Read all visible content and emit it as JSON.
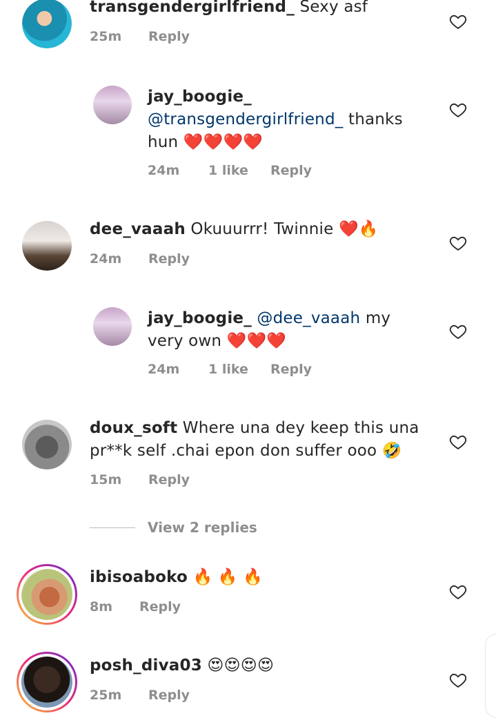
{
  "comments": [
    {
      "username": "transgendergirlfriend_",
      "text": "Sexy asf",
      "time": "25m",
      "likes": "",
      "reply": "Reply"
    },
    {
      "username": "jay_boogie_",
      "mention": "@transgendergirlfriend_",
      "text": "thanks hun",
      "emoji": "❤️❤️❤️❤️",
      "time": "24m",
      "likes": "1 like",
      "reply": "Reply"
    },
    {
      "username": "dee_vaaah",
      "text": "Okuuurrr! Twinnie",
      "emoji": "❤️🔥",
      "time": "24m",
      "likes": "",
      "reply": "Reply"
    },
    {
      "username": "jay_boogie_",
      "mention": "@dee_vaaah",
      "text": "my very own",
      "emoji": "❤️❤️❤️",
      "time": "24m",
      "likes": "1 like",
      "reply": "Reply"
    },
    {
      "username": "doux_soft",
      "text": "Where una dey keep this una pr**k self .chai epon don suffer ooo",
      "emoji": "🤣",
      "time": "15m",
      "likes": "",
      "reply": "Reply"
    },
    {
      "username": "ibisoaboko",
      "text": "",
      "emoji": "🔥 🔥 🔥",
      "time": "8m",
      "likes": "",
      "reply": "Reply"
    },
    {
      "username": "posh_diva03",
      "text": "",
      "emoji": "😍😍😍😍",
      "time": "25m",
      "likes": "",
      "reply": "Reply"
    }
  ],
  "view_replies": "View 2 replies",
  "colors": {
    "mention": "#00376b",
    "meta": "#8e8e8e",
    "story_ring_start": "#f58529",
    "story_ring_end": "#dd2a7b"
  },
  "icons": {
    "like": "heart-outline-icon"
  }
}
